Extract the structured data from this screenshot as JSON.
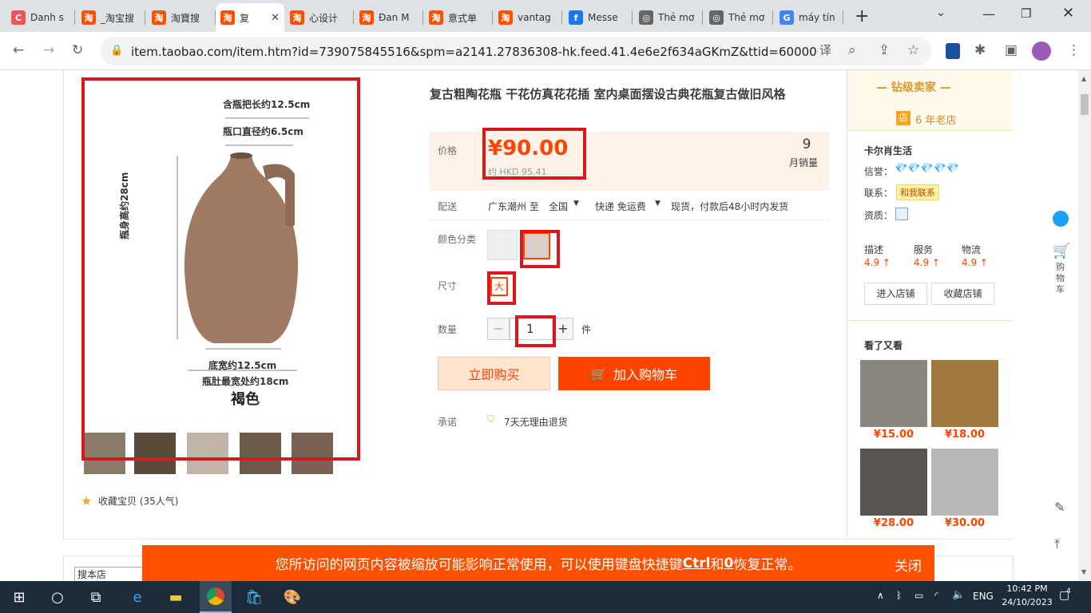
{
  "browser": {
    "tabs": [
      {
        "title": "Danh s",
        "fav_color": "#e55",
        "fav_char": "C"
      },
      {
        "title": "_淘宝搜",
        "fav_color": "#ff5000",
        "fav_char": "淘"
      },
      {
        "title": "淘寶搜",
        "fav_color": "#ff5000",
        "fav_char": "淘"
      },
      {
        "title": "复",
        "fav_color": "#ff5000",
        "fav_char": "淘"
      },
      {
        "title": "心设计",
        "fav_color": "#ff5000",
        "fav_char": "淘"
      },
      {
        "title": "Đan M",
        "fav_color": "#ff5000",
        "fav_char": "淘"
      },
      {
        "title": "意式单",
        "fav_color": "#ff5000",
        "fav_char": "淘"
      },
      {
        "title": "vantag",
        "fav_color": "#ff5000",
        "fav_char": "淘"
      },
      {
        "title": "Messe",
        "fav_color": "#1877f2",
        "fav_char": "f"
      },
      {
        "title": "Thẻ mơ",
        "fav_color": "#666",
        "fav_char": "◎"
      },
      {
        "title": "Thẻ mơ",
        "fav_color": "#666",
        "fav_char": "◎"
      },
      {
        "title": "máy tín",
        "fav_color": "#4285f4",
        "fav_char": "G"
      }
    ],
    "url": "item.taobao.com/item.htm?id=739075845516&spm=a2141.27836308-hk.feed.41.4e6e2f634aGKmZ&ttid=600000..."
  },
  "product": {
    "title": "复古粗陶花瓶 干花仿真花花插 室内桌面摆设古典花瓶复古做旧风格",
    "image_annotations": {
      "handle_length": "含瓶把长约12.5cm",
      "mouth_diameter": "瓶口直径约6.5cm",
      "body_height": "瓶身高约28cm",
      "base_width": "底宽约12.5cm",
      "belly_width": "瓶肚最宽处约18cm",
      "color_name": "褐色"
    },
    "favorite": "收藏宝贝 (35人气)",
    "price_label": "价格",
    "price": "¥90.00",
    "price_hkd": "约 HKD 95.41",
    "monthly_sales_count": "9",
    "monthly_sales_label": "月销量",
    "delivery_label": "配送",
    "delivery_from": "广东潮州 至",
    "delivery_to": "全国",
    "shipping": "快递 免运费",
    "stock_note": "现货，付款后48小时内发货",
    "color_label": "颜色分类",
    "size_label": "尺寸",
    "size_value": "大",
    "qty_label": "数量",
    "qty_value": "1",
    "qty_unit": "件",
    "buy_now": "立即购买",
    "add_cart": "加入购物车",
    "promise_label": "承诺",
    "promise_value": "7天无理由退货"
  },
  "shop": {
    "level": "钻级卖家",
    "age": "6 年老店",
    "name": "卡尔肖生活",
    "credit_label": "信誉：",
    "contact_label": "联系：",
    "contact_btn": "和我联系",
    "qual_label": "资质：",
    "scores": [
      {
        "label": "描述",
        "value": "4.9 ↑"
      },
      {
        "label": "服务",
        "value": "4.9 ↑"
      },
      {
        "label": "物流",
        "value": "4.9 ↑"
      }
    ],
    "enter_shop": "进入店铺",
    "fav_shop": "收藏店铺",
    "related_title": "看了又看",
    "related": [
      {
        "price": "¥15.00",
        "color": "#8a8680"
      },
      {
        "price": "¥18.00",
        "color": "#a07840"
      },
      {
        "price": "¥28.00",
        "color": "#5a5550"
      },
      {
        "price": "¥30.00",
        "color": "#b8b8b8"
      }
    ]
  },
  "sidebar_right": {
    "cart_label": "购物车"
  },
  "search_shop_placeholder": "搜本店",
  "banner": {
    "text_a": "您所访问的网页内容被缩放可能影响正常使用，可以使用键盘快捷键 ",
    "key1": "Ctrl",
    "text_b": " 和 ",
    "key2": "0",
    "text_c": " 恢复正常。",
    "close": "关闭"
  },
  "taskbar": {
    "lang": "ENG",
    "time": "10:42 PM",
    "date": "24/10/2023",
    "notif": "4"
  }
}
